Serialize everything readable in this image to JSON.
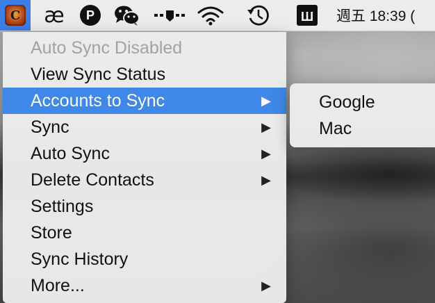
{
  "menubar": {
    "app_icon_letter": "C",
    "ae_label": "æ",
    "p_label": "P",
    "mw_label": "Ш",
    "datetime": "週五 18:39 ("
  },
  "menu": {
    "items": [
      {
        "label": "Auto Sync Disabled",
        "disabled": true,
        "submenu": false
      },
      {
        "label": "View Sync Status",
        "disabled": false,
        "submenu": false
      },
      {
        "label": "Accounts to Sync",
        "disabled": false,
        "submenu": true,
        "highlighted": true
      },
      {
        "label": "Sync",
        "disabled": false,
        "submenu": true
      },
      {
        "label": "Auto Sync",
        "disabled": false,
        "submenu": true
      },
      {
        "label": "Delete Contacts",
        "disabled": false,
        "submenu": true
      },
      {
        "label": "Settings",
        "disabled": false,
        "submenu": false
      },
      {
        "label": "Store",
        "disabled": false,
        "submenu": false
      },
      {
        "label": "Sync History",
        "disabled": false,
        "submenu": false
      },
      {
        "label": "More...",
        "disabled": false,
        "submenu": true
      }
    ],
    "submenu_arrow": "▶"
  },
  "submenu": {
    "items": [
      {
        "label": "Google"
      },
      {
        "label": "Mac"
      }
    ]
  },
  "colors": {
    "highlight": "#3f87e8",
    "menubar_active": "#3b7ee6"
  }
}
